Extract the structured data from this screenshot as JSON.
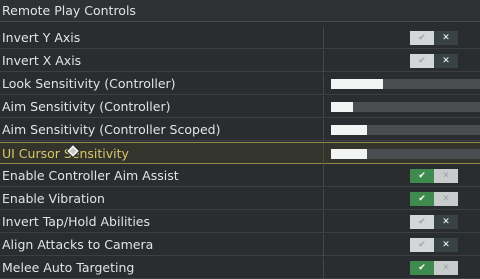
{
  "header": {
    "title": "Remote Play Controls"
  },
  "settings": [
    {
      "label": "Invert Y Axis",
      "type": "toggle",
      "value": false
    },
    {
      "label": "Invert X Axis",
      "type": "toggle",
      "value": false
    },
    {
      "label": "Look Sensitivity (Controller)",
      "type": "slider",
      "level": 0.35
    },
    {
      "label": "Aim Sensitivity (Controller)",
      "type": "slider",
      "level": 0.15
    },
    {
      "label": "Aim Sensitivity (Controller Scoped)",
      "type": "slider",
      "level": 0.24
    },
    {
      "label": "UI Cursor Sensitivity",
      "type": "slider",
      "level": 0.24,
      "selected": true
    },
    {
      "label": "Enable Controller Aim Assist",
      "type": "toggle",
      "value": true
    },
    {
      "label": "Enable Vibration",
      "type": "toggle",
      "value": true
    },
    {
      "label": "Invert Tap/Hold Abilities",
      "type": "toggle",
      "value": false
    },
    {
      "label": "Align Attacks to Camera",
      "type": "toggle",
      "value": false
    },
    {
      "label": "Melee Auto Targeting",
      "type": "toggle",
      "value": true
    }
  ],
  "toggle_glyphs": {
    "on": "✔",
    "off": "✕"
  },
  "icons": {
    "cursor": "controller-cursor-icon"
  },
  "colors": {
    "background": "#2a2d2f",
    "selected_text": "#d8c66a",
    "toggle_on": "#3f8a4e",
    "slider_fill": "#f2f3f3"
  }
}
